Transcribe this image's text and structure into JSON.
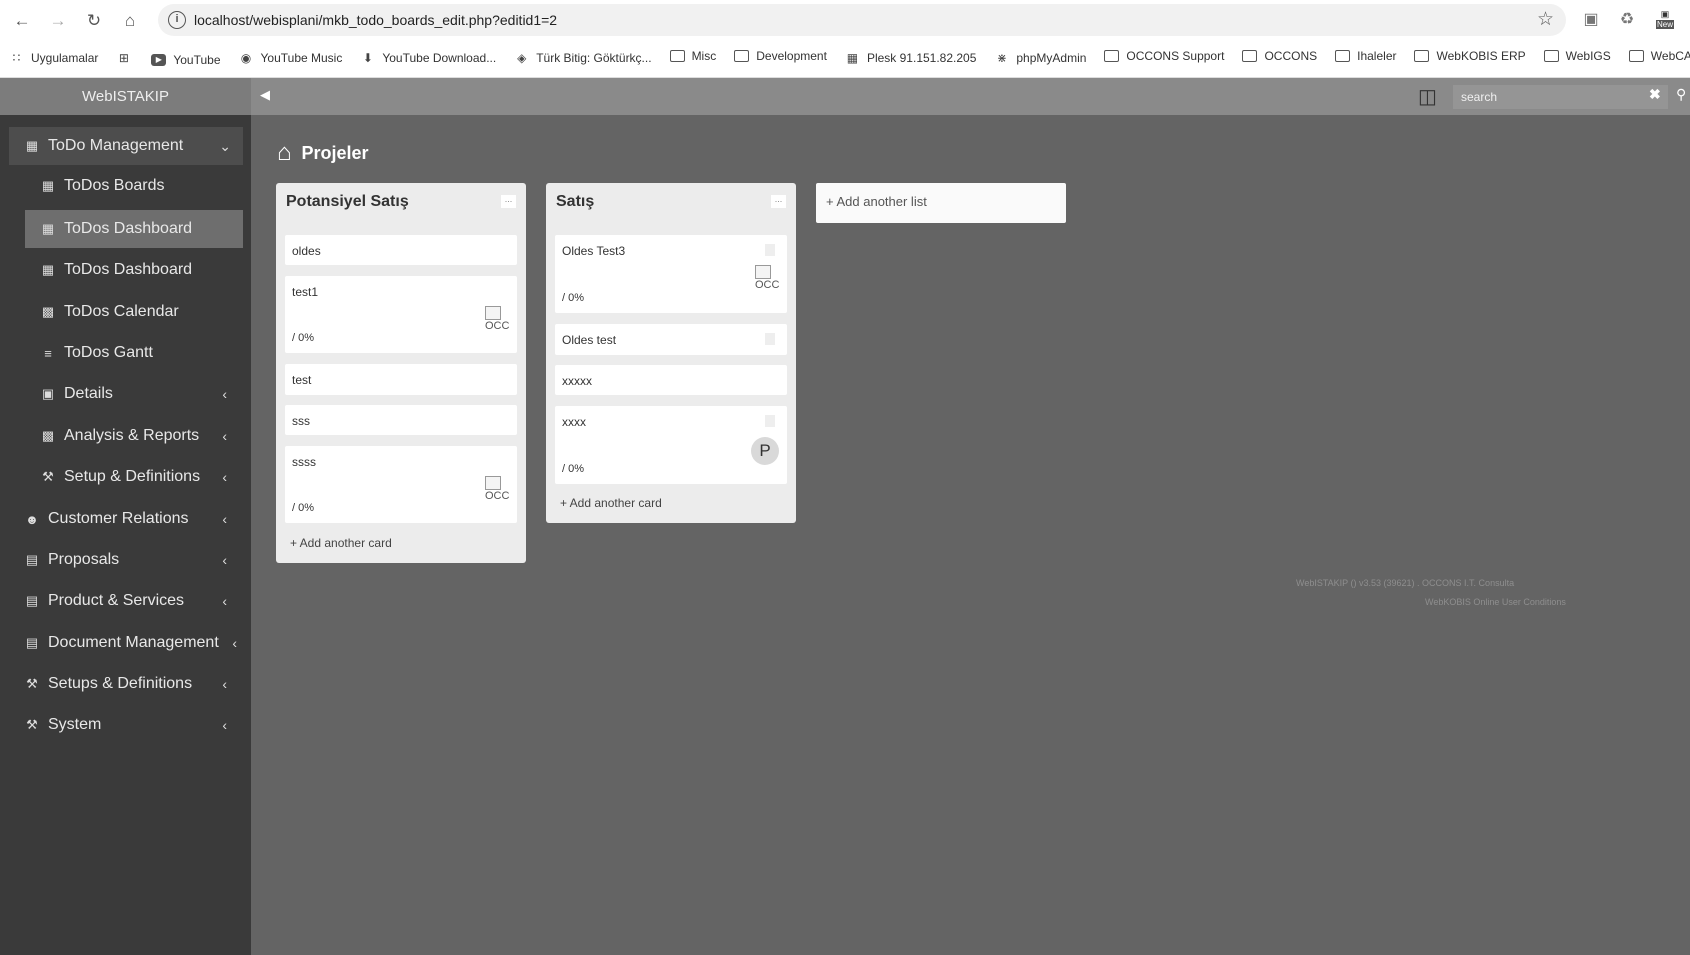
{
  "browser": {
    "url": "localhost/webisplani/mkb_todo_boards_edit.php?editid1=2",
    "bookmarks": [
      {
        "label": "Uygulamalar",
        "icon": "apps-grid-icon"
      },
      {
        "label": "",
        "icon": "grid-icon"
      },
      {
        "label": "YouTube",
        "icon": "youtube-icon"
      },
      {
        "label": "YouTube Music",
        "icon": "youtube-music-icon"
      },
      {
        "label": "YouTube Download...",
        "icon": "download-icon"
      },
      {
        "label": "Türk Bitig: Göktürkç...",
        "icon": "gem-icon"
      },
      {
        "label": "Misc",
        "icon": "folder-icon"
      },
      {
        "label": "Development",
        "icon": "folder-icon"
      },
      {
        "label": "Plesk 91.151.82.205",
        "icon": "plesk-icon"
      },
      {
        "label": "phpMyAdmin",
        "icon": "phpmyadmin-icon"
      },
      {
        "label": "OCCONS Support",
        "icon": "folder-icon"
      },
      {
        "label": "OCCONS",
        "icon": "folder-icon"
      },
      {
        "label": "Ihaleler",
        "icon": "folder-icon"
      },
      {
        "label": "WebKOBIS ERP",
        "icon": "folder-icon"
      },
      {
        "label": "WebIGS",
        "icon": "folder-icon"
      },
      {
        "label": "WebCA",
        "icon": "folder-icon"
      }
    ],
    "ext_badge": "New"
  },
  "app": {
    "brand": "WebISTAKIP",
    "search_placeholder": "search"
  },
  "sidebar": {
    "items": [
      {
        "label": "ToDo Management",
        "icon": "table-icon"
      },
      {
        "label": "ToDos Boards",
        "icon": "table-icon"
      },
      {
        "label": "ToDos Dashboard",
        "icon": "table-icon"
      },
      {
        "label": "ToDos Dashboard",
        "icon": "calendar-grid-icon"
      },
      {
        "label": "ToDos Calendar",
        "icon": "calendar-icon"
      },
      {
        "label": "ToDos Gantt",
        "icon": "gantt-icon"
      },
      {
        "label": "Details",
        "icon": "details-icon"
      },
      {
        "label": "Analysis & Reports",
        "icon": "bar-chart-icon"
      },
      {
        "label": "Setup & Definitions",
        "icon": "wrench-icon"
      },
      {
        "label": "Customer Relations",
        "icon": "users-icon"
      },
      {
        "label": "Proposals",
        "icon": "proposal-icon"
      },
      {
        "label": "Product & Services",
        "icon": "product-icon"
      },
      {
        "label": "Document Management",
        "icon": "document-icon"
      },
      {
        "label": "Setups & Definitions",
        "icon": "tools-icon"
      },
      {
        "label": "System",
        "icon": "tools-icon"
      }
    ]
  },
  "page": {
    "title": "Projeler"
  },
  "board": {
    "lists": [
      {
        "title": "Potansiyel Satış",
        "menu": "...",
        "cards": [
          {
            "title": "oldes"
          },
          {
            "title": "test1",
            "pct": "/ 0%",
            "img_alt": "OCC"
          },
          {
            "title": "test"
          },
          {
            "title": "sss"
          },
          {
            "title": "ssss",
            "pct": "/ 0%",
            "img_alt": "OCC"
          }
        ],
        "add_card": "+ Add another card"
      },
      {
        "title": "Satış",
        "menu": "...",
        "cards": [
          {
            "title": "Oldes Test3",
            "pct": "/ 0%",
            "img_alt": "OCC"
          },
          {
            "title": "Oldes test"
          },
          {
            "title": "xxxxx"
          },
          {
            "title": "xxxx",
            "pct": "/ 0%",
            "avatar": "P"
          }
        ],
        "add_card": "+ Add another card"
      }
    ],
    "add_list": "+ Add another list"
  },
  "footer": {
    "line1": "WebISTAKIP () v3.53 (39621) . OCCONS I.T. Consulta",
    "line2": "WebKOBIS Online User Conditions"
  }
}
